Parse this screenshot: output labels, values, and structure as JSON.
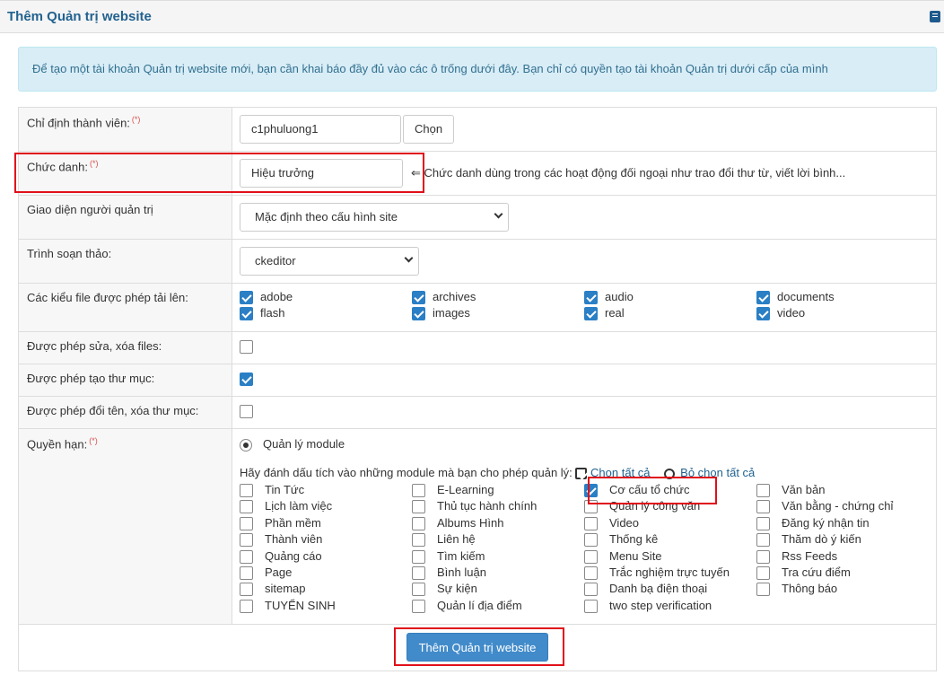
{
  "header": {
    "title": "Thêm Quản trị website",
    "icon": "book-icon"
  },
  "info": "Để tạo một tài khoản Quản trị website mới, bạn cần khai báo đầy đủ vào các ô trống dưới đây. Bạn chỉ có quyền tạo tài khoản Quản trị dưới cấp của mình",
  "form": {
    "member": {
      "label": "Chỉ định thành viên:",
      "required": "(*)",
      "value": "c1phuluong1",
      "button": "Chọn"
    },
    "position": {
      "label": "Chức danh:",
      "required": "(*)",
      "value": "Hiệu trưởng",
      "hint": "⇐ Chức danh dùng trong các hoạt động đối ngoại như trao đổi thư từ, viết lời bình..."
    },
    "theme": {
      "label": "Giao diện người quản trị",
      "value": "Mặc định theo cấu hình site"
    },
    "editor": {
      "label": "Trình soạn thảo:",
      "value": "ckeditor"
    },
    "filetypes": {
      "label": "Các kiểu file được phép tải lên:",
      "items": [
        {
          "name": "adobe",
          "checked": true
        },
        {
          "name": "archives",
          "checked": true
        },
        {
          "name": "audio",
          "checked": true
        },
        {
          "name": "documents",
          "checked": true
        },
        {
          "name": "flash",
          "checked": true
        },
        {
          "name": "images",
          "checked": true
        },
        {
          "name": "real",
          "checked": true
        },
        {
          "name": "video",
          "checked": true
        }
      ]
    },
    "allow_edit_files": {
      "label": "Được phép sửa, xóa files:",
      "checked": false
    },
    "allow_create_dir": {
      "label": "Được phép tạo thư mục:",
      "checked": true
    },
    "allow_rename_dir": {
      "label": "Được phép đổi tên, xóa thư mục:",
      "checked": false
    },
    "permissions": {
      "label": "Quyền hạn:",
      "required": "(*)",
      "radio_label": "Quản lý module",
      "instruction": "Hãy đánh dấu tích vào những module mà bạn cho phép quản lý:",
      "select_all": "Chọn tất cả",
      "deselect_all": "Bỏ chọn tất cả",
      "modules": [
        {
          "name": "Tin Tức",
          "checked": false
        },
        {
          "name": "E-Learning",
          "checked": false
        },
        {
          "name": "Cơ cấu tổ chức",
          "checked": true
        },
        {
          "name": "Văn bản",
          "checked": false
        },
        {
          "name": "Lịch làm việc",
          "checked": false
        },
        {
          "name": "Thủ tục hành chính",
          "checked": false
        },
        {
          "name": "Quản lý công văn",
          "checked": false
        },
        {
          "name": "Văn bằng - chứng chỉ",
          "checked": false
        },
        {
          "name": "Phần mềm",
          "checked": false
        },
        {
          "name": "Albums Hình",
          "checked": false
        },
        {
          "name": "Video",
          "checked": false
        },
        {
          "name": "Đăng ký nhận tin",
          "checked": false
        },
        {
          "name": "Thành viên",
          "checked": false
        },
        {
          "name": "Liên hệ",
          "checked": false
        },
        {
          "name": "Thống kê",
          "checked": false
        },
        {
          "name": "Thăm dò ý kiến",
          "checked": false
        },
        {
          "name": "Quảng cáo",
          "checked": false
        },
        {
          "name": "Tìm kiếm",
          "checked": false
        },
        {
          "name": "Menu Site",
          "checked": false
        },
        {
          "name": "Rss Feeds",
          "checked": false
        },
        {
          "name": "Page",
          "checked": false
        },
        {
          "name": "Bình luận",
          "checked": false
        },
        {
          "name": "Trắc nghiệm trực tuyến",
          "checked": false
        },
        {
          "name": "Tra cứu điểm",
          "checked": false
        },
        {
          "name": "sitemap",
          "checked": false
        },
        {
          "name": "Sự kiện",
          "checked": false
        },
        {
          "name": "Danh bạ điện thoại",
          "checked": false
        },
        {
          "name": "Thông báo",
          "checked": false
        },
        {
          "name": "TUYỂN SINH",
          "checked": false
        },
        {
          "name": "Quản lí địa điểm",
          "checked": false
        },
        {
          "name": "two step verification",
          "checked": false
        }
      ]
    },
    "submit": "Thêm Quản trị website"
  },
  "colors": {
    "accent": "#22628f",
    "primary_button": "#428bca",
    "highlight": "#e0101a",
    "info_bg": "#d9edf7"
  }
}
